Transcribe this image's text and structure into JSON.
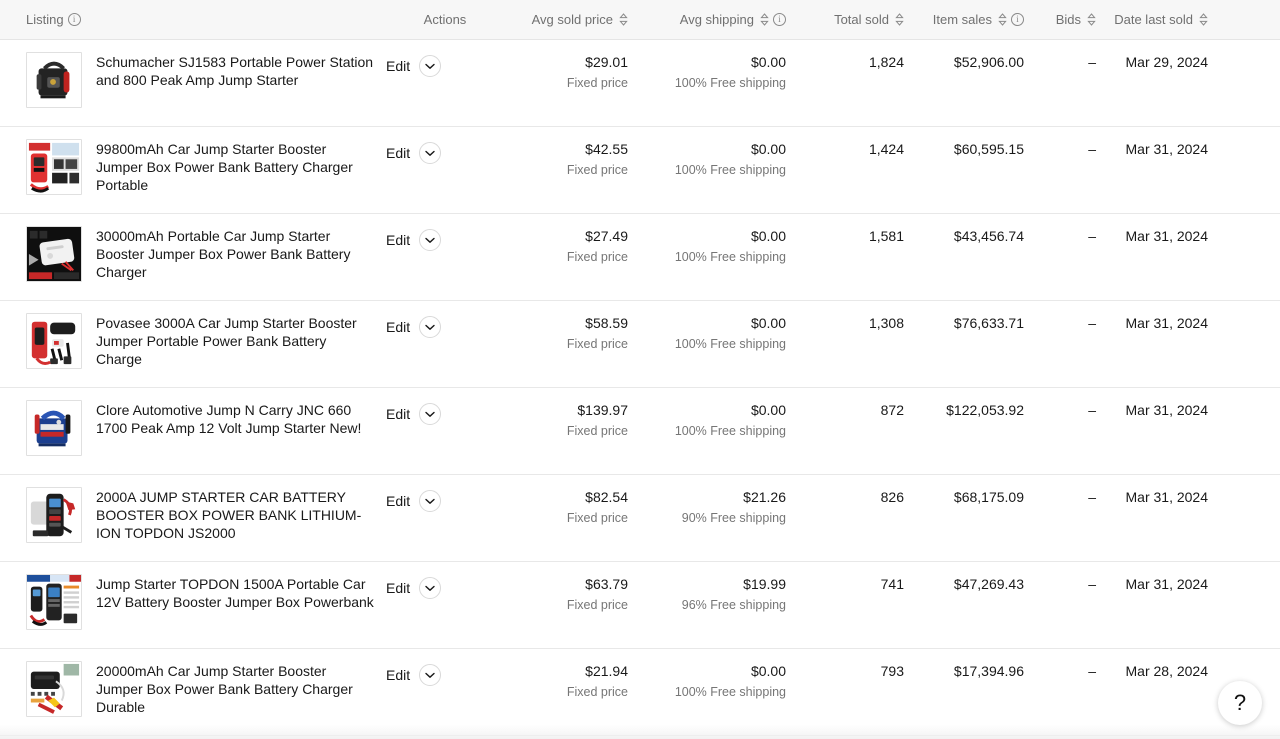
{
  "table": {
    "columns": [
      {
        "key": "listing",
        "label": "Listing",
        "info": true,
        "sortable": false
      },
      {
        "key": "actions",
        "label": "Actions",
        "info": false,
        "sortable": false
      },
      {
        "key": "avg_price",
        "label": "Avg sold price",
        "info": false,
        "sortable": true
      },
      {
        "key": "avg_ship",
        "label": "Avg shipping",
        "info": true,
        "sortable": true
      },
      {
        "key": "total",
        "label": "Total sold",
        "info": false,
        "sortable": true
      },
      {
        "key": "sales",
        "label": "Item sales",
        "info": true,
        "sortable": true
      },
      {
        "key": "bids",
        "label": "Bids",
        "info": false,
        "sortable": true
      },
      {
        "key": "date",
        "label": "Date last sold",
        "info": false,
        "sortable": true
      }
    ],
    "action_label": "Edit",
    "rows": [
      {
        "title": "Schumacher SJ1583 Portable Power Station and 800 Peak Amp Jump Starter",
        "thumb": "schumacher-black-red-jump-starter",
        "avg_sold_price": "$29.01",
        "price_type": "Fixed price",
        "avg_shipping": "$0.00",
        "shipping_note": "100% Free shipping",
        "total_sold": "1,824",
        "item_sales": "$52,906.00",
        "bids": "–",
        "date_last_sold": "Mar 29, 2024"
      },
      {
        "title": "99800mAh Car Jump Starter Booster Jumper Box Power Bank Battery Charger Portable",
        "thumb": "red-jump-starter-kit-collage",
        "avg_sold_price": "$42.55",
        "price_type": "Fixed price",
        "avg_shipping": "$0.00",
        "shipping_note": "100% Free shipping",
        "total_sold": "1,424",
        "item_sales": "$60,595.15",
        "bids": "–",
        "date_last_sold": "Mar 31, 2024"
      },
      {
        "title": "30000mAh Portable Car Jump Starter Booster Jumper Box Power Bank Battery Charger",
        "thumb": "white-powerbank-jump-starter",
        "avg_sold_price": "$27.49",
        "price_type": "Fixed price",
        "avg_shipping": "$0.00",
        "shipping_note": "100% Free shipping",
        "total_sold": "1,581",
        "item_sales": "$43,456.74",
        "bids": "–",
        "date_last_sold": "Mar 31, 2024"
      },
      {
        "title": "Povasee 3000A Car Jump Starter Booster Jumper Portable Power Bank Battery Charge",
        "thumb": "povasee-red-black-jump-starter",
        "avg_sold_price": "$58.59",
        "price_type": "Fixed price",
        "avg_shipping": "$0.00",
        "shipping_note": "100% Free shipping",
        "total_sold": "1,308",
        "item_sales": "$76,633.71",
        "bids": "–",
        "date_last_sold": "Mar 31, 2024"
      },
      {
        "title": "Clore Automotive Jump N Carry JNC 660 1700 Peak Amp 12 Volt Jump Starter New!",
        "thumb": "clore-blue-jump-n-carry",
        "avg_sold_price": "$139.97",
        "price_type": "Fixed price",
        "avg_shipping": "$0.00",
        "shipping_note": "100% Free shipping",
        "total_sold": "872",
        "item_sales": "$122,053.92",
        "bids": "–",
        "date_last_sold": "Mar 31, 2024"
      },
      {
        "title": "2000A JUMP STARTER CAR BATTERY BOOSTER BOX POWER BANK LITHIUM-ION TOPDON JS2000",
        "thumb": "topdon-js2000-black-jump-starter",
        "avg_sold_price": "$82.54",
        "price_type": "Fixed price",
        "avg_shipping": "$21.26",
        "shipping_note": "90% Free shipping",
        "total_sold": "826",
        "item_sales": "$68,175.09",
        "bids": "–",
        "date_last_sold": "Mar 31, 2024"
      },
      {
        "title": "Jump Starter TOPDON 1500A Portable Car 12V Battery Booster Jumper Box Powerbank",
        "thumb": "topdon-1500a-listing-graphic",
        "avg_sold_price": "$63.79",
        "price_type": "Fixed price",
        "avg_shipping": "$19.99",
        "shipping_note": "96% Free shipping",
        "total_sold": "741",
        "item_sales": "$47,269.43",
        "bids": "–",
        "date_last_sold": "Mar 31, 2024"
      },
      {
        "title": "20000mAh Car Jump Starter Booster Jumper Box Power Bank Battery Charger Durable",
        "thumb": "black-20000mah-jump-starter-clamps",
        "avg_sold_price": "$21.94",
        "price_type": "Fixed price",
        "avg_shipping": "$0.00",
        "shipping_note": "100% Free shipping",
        "total_sold": "793",
        "item_sales": "$17,394.96",
        "bids": "–",
        "date_last_sold": "Mar 28, 2024"
      }
    ]
  },
  "help": {
    "label": "?"
  }
}
